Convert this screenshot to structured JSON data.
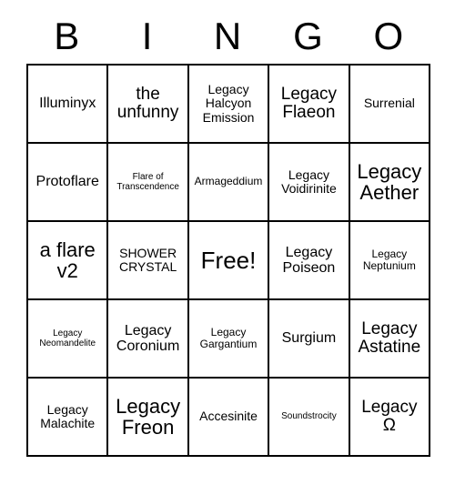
{
  "card": {
    "header_letters": [
      "B",
      "I",
      "N",
      "G",
      "O"
    ],
    "rows": [
      [
        {
          "text": "Illuminyx",
          "size": "fs-lg"
        },
        {
          "text": "the unfunny",
          "size": "fs-xl"
        },
        {
          "text": "Legacy Halcyon Emission",
          "size": "fs-md"
        },
        {
          "text": "Legacy Flaeon",
          "size": "fs-xl"
        },
        {
          "text": "Surrenial",
          "size": "fs-md"
        }
      ],
      [
        {
          "text": "Protoflare",
          "size": "fs-lg"
        },
        {
          "text": "Flare of Transcendence",
          "size": "fs-xs"
        },
        {
          "text": "Armageddium",
          "size": "fs-sm"
        },
        {
          "text": "Legacy Voidirinite",
          "size": "fs-md"
        },
        {
          "text": "Legacy Aether",
          "size": "fs-xxl"
        }
      ],
      [
        {
          "text": "a flare v2",
          "size": "fs-xxl"
        },
        {
          "text": "SHOWER CRYSTAL",
          "size": "fs-md"
        },
        {
          "text": "Free!",
          "size": "fs-free"
        },
        {
          "text": "Legacy Poiseon",
          "size": "fs-lg"
        },
        {
          "text": "Legacy Neptunium",
          "size": "fs-sm"
        }
      ],
      [
        {
          "text": "Legacy Neomandelite",
          "size": "fs-xs"
        },
        {
          "text": "Legacy Coronium",
          "size": "fs-lg"
        },
        {
          "text": "Legacy Gargantium",
          "size": "fs-sm"
        },
        {
          "text": "Surgium",
          "size": "fs-lg"
        },
        {
          "text": "Legacy Astatine",
          "size": "fs-xl"
        }
      ],
      [
        {
          "text": "Legacy Malachite",
          "size": "fs-md"
        },
        {
          "text": "Legacy Freon",
          "size": "fs-xxl"
        },
        {
          "text": "Accesinite",
          "size": "fs-md"
        },
        {
          "text": "Soundstrocity",
          "size": "fs-xs"
        },
        {
          "text": "Legacy Ω",
          "size": "fs-xl"
        }
      ]
    ]
  }
}
